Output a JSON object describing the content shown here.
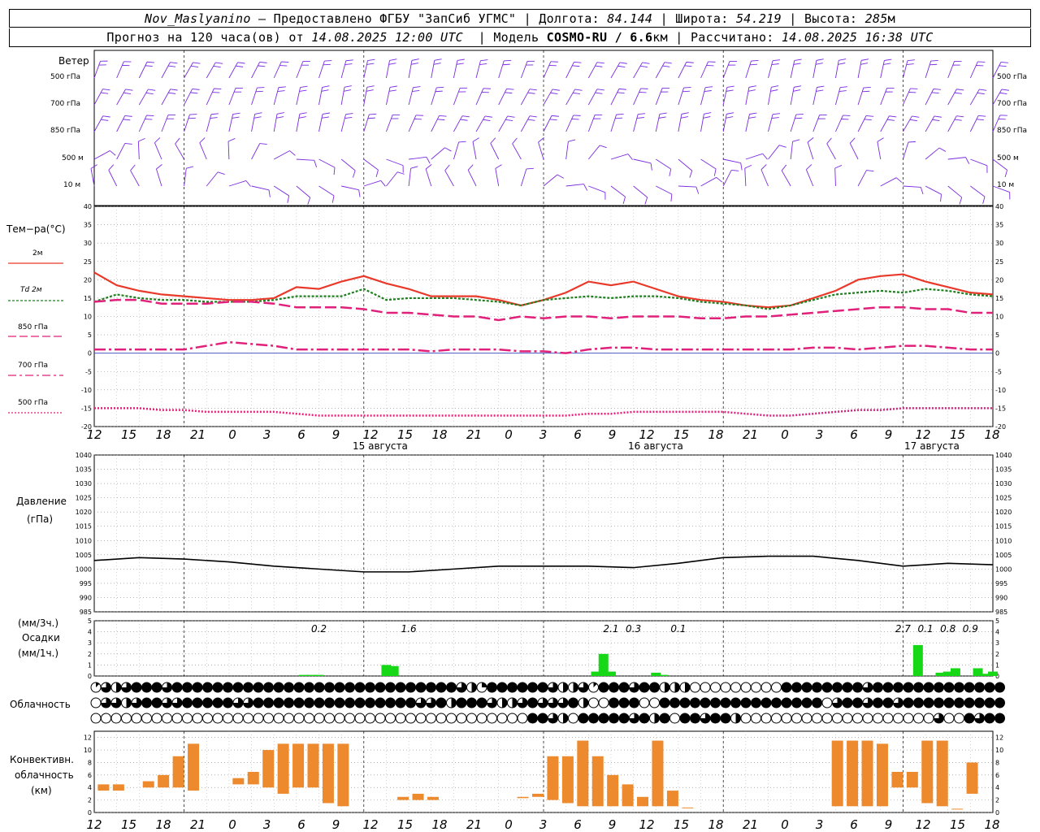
{
  "header": {
    "station": "Nov_Maslyanino",
    "provider": "Предоставлено ФГБУ \"ЗапСиб УГМС\"",
    "lon_label": "Долгота:",
    "lon": "84.144",
    "lat_label": "Широта:",
    "lat": "54.219",
    "alt_label": "Высота:",
    "alt": "285",
    "alt_unit": "м",
    "forecast_prefix": "Прогноз на 120 часа(ов) от",
    "forecast_time": "14.08.2025 12:00 UTC",
    "model_label": "Модель",
    "model": "COSMO-RU / 6.6",
    "model_unit": "км",
    "calc_label": "Рассчитано:",
    "calc_time": "14.08.2025 16:38 UTC"
  },
  "labels": {
    "wind": "Ветер",
    "levels": [
      "500 гПа",
      "700 гПа",
      "850 гПа",
      "500 м",
      "10  м"
    ],
    "temp": "Тем−ра(°С)",
    "t2m": "2м",
    "td": "Td  2м",
    "t850": "850 гПа",
    "t700": "700 гПа",
    "t500": "500 гПа",
    "pressure": "Давление",
    "pressure_unit": "(гПа)",
    "precip_unit3": "(мм/3ч.)",
    "precip": "Осадки",
    "precip_unit1": "(мм/1ч.)",
    "clouds": "Облачность",
    "conv1": "Конвективн.",
    "conv2": "облачность",
    "conv3": "(км)",
    "dates": [
      "15 августа",
      "16 августа",
      "17 августа"
    ],
    "hours": [
      "12",
      "15",
      "18",
      "21",
      "0",
      "3",
      "6",
      "9",
      "12",
      "15",
      "18",
      "21",
      "0",
      "3",
      "6",
      "9",
      "12",
      "15",
      "18",
      "21",
      "0",
      "3",
      "6",
      "9",
      "12",
      "15",
      "18"
    ]
  },
  "colors": {
    "t2m": "#e8392a",
    "td": "#1e7f1e",
    "t850": "#e0207a",
    "t700": "#e0207a",
    "t500": "#e0207a",
    "wind": "#7b2be0",
    "precip": "#17d817",
    "conv": "#ee8a2e",
    "pressure": "#000000"
  },
  "chart_data": [
    {
      "type": "line",
      "name": "temperature",
      "ylim": [
        -20,
        40
      ],
      "x_hours": [
        0,
        3,
        6,
        9,
        12,
        15,
        18,
        21,
        24,
        27,
        30,
        33,
        36,
        39,
        42,
        45,
        48,
        51,
        54,
        57,
        60,
        63,
        66,
        69,
        72,
        75,
        78,
        81,
        84,
        87,
        90,
        93,
        96,
        99,
        102,
        105,
        108,
        111,
        114,
        117,
        120
      ],
      "series": [
        {
          "name": "2м",
          "values": [
            22,
            18.5,
            17,
            16,
            15.5,
            15,
            14.5,
            14.5,
            15,
            18,
            17.5,
            19.5,
            21,
            19,
            17.5,
            15.5,
            15.5,
            15.5,
            14.5,
            13,
            14.5,
            16.5,
            19.5,
            18.5,
            19.5,
            17.5,
            15.5,
            14.5,
            14,
            13,
            12.5,
            13,
            15,
            17,
            20,
            21,
            21.5,
            19.5,
            18,
            16.5,
            16
          ]
        },
        {
          "name": "Td 2м",
          "values": [
            14,
            16,
            15,
            14.5,
            14.5,
            14,
            14,
            14,
            14.5,
            15.5,
            15.5,
            15.5,
            17.5,
            14.5,
            15,
            15,
            15,
            14.5,
            14,
            13,
            14.5,
            15,
            15.5,
            15,
            15.5,
            15.5,
            15,
            14,
            13.5,
            13,
            12,
            13,
            14.5,
            16,
            16.5,
            17,
            16.5,
            17.5,
            17,
            16,
            15.5
          ]
        },
        {
          "name": "850 гПа",
          "values": [
            14,
            14.5,
            14.5,
            13.5,
            13.5,
            13.5,
            14,
            14,
            13.5,
            12.5,
            12.5,
            12.5,
            12,
            11,
            11,
            10.5,
            10,
            10,
            9,
            10,
            9.5,
            10,
            10,
            9.5,
            10,
            10,
            10,
            9.5,
            9.5,
            10,
            10,
            10.5,
            11,
            11.5,
            12,
            12.5,
            12.5,
            12,
            12,
            11,
            11
          ]
        },
        {
          "name": "700 гПа",
          "values": [
            1,
            1,
            1,
            1,
            1,
            2,
            3,
            2.5,
            2,
            1,
            1,
            1,
            1,
            1,
            1,
            0.5,
            1,
            1,
            1,
            0.5,
            0.5,
            0,
            1,
            1.5,
            1.5,
            1,
            1,
            1,
            1,
            1,
            1,
            1,
            1.5,
            1.5,
            1,
            1.5,
            2,
            2,
            1.5,
            1,
            1
          ]
        },
        {
          "name": "500 гПа",
          "values": [
            -15,
            -15,
            -15,
            -15.5,
            -15.5,
            -16,
            -16,
            -16,
            -16,
            -16.5,
            -17,
            -17,
            -17,
            -17,
            -17,
            -17,
            -17,
            -17,
            -17,
            -17,
            -17,
            -17,
            -16.5,
            -16.5,
            -16,
            -16,
            -16,
            -16,
            -16,
            -16.5,
            -17,
            -17,
            -16.5,
            -16,
            -15.5,
            -15.5,
            -15,
            -15,
            -15,
            -15,
            -15
          ]
        }
      ]
    },
    {
      "type": "line",
      "name": "pressure",
      "ylim": [
        985,
        1040
      ],
      "x_hours": [
        0,
        6,
        12,
        18,
        24,
        30,
        36,
        42,
        48,
        54,
        60,
        66,
        72,
        78,
        84,
        90,
        96,
        102,
        108,
        114,
        120
      ],
      "series": [
        {
          "name": "pressure",
          "values": [
            1003,
            1004,
            1003.5,
            1002.5,
            1001,
            1000,
            999,
            999,
            1000,
            1001,
            1001,
            1001,
            1000.5,
            1002,
            1004,
            1004.5,
            1004.5,
            1003,
            1001,
            1002,
            1001.5
          ]
        }
      ]
    },
    {
      "type": "bar",
      "name": "precipitation",
      "ylim": [
        0,
        5
      ],
      "labels": [
        {
          "x_hour": 30,
          "text": "0.2"
        },
        {
          "x_hour": 42,
          "text": "1.6"
        },
        {
          "x_hour": 69,
          "text": "2.1"
        },
        {
          "x_hour": 72,
          "text": "0.3"
        },
        {
          "x_hour": 78,
          "text": "0.1"
        },
        {
          "x_hour": 108,
          "text": "2.7"
        },
        {
          "x_hour": 111,
          "text": "0.1"
        },
        {
          "x_hour": 114,
          "text": "0.8"
        },
        {
          "x_hour": 117,
          "text": "0.9"
        }
      ],
      "bars": [
        [
          28,
          0.1
        ],
        [
          29,
          0.1
        ],
        [
          30,
          0.1
        ],
        [
          39,
          1
        ],
        [
          40,
          0.9
        ],
        [
          67,
          0.4
        ],
        [
          68,
          2
        ],
        [
          69,
          0.4
        ],
        [
          75,
          0.3
        ],
        [
          76,
          0.1
        ],
        [
          110,
          2.8
        ],
        [
          113,
          0.3
        ],
        [
          114,
          0.4
        ],
        [
          115,
          0.7
        ],
        [
          118,
          0.7
        ],
        [
          119,
          0.2
        ],
        [
          120,
          0.4
        ]
      ]
    },
    {
      "type": "bar",
      "name": "convective",
      "ylim": [
        0,
        13
      ],
      "x_hours": [
        2,
        4,
        6,
        8,
        10,
        12,
        14,
        16,
        18,
        20,
        22,
        24,
        26,
        28,
        30,
        32,
        34,
        36,
        38,
        40,
        42,
        44,
        46,
        48,
        50,
        52,
        54,
        56,
        58,
        60,
        62,
        64,
        66,
        68,
        70,
        72,
        74,
        76,
        78,
        80,
        82,
        84,
        86,
        88,
        90,
        92,
        94,
        96,
        98,
        100,
        102,
        104,
        106,
        108,
        110,
        112,
        114,
        116,
        118,
        120
      ],
      "ranges": [
        [
          3.5,
          4.5
        ],
        [
          3.5,
          4.5
        ],
        null,
        [
          4,
          5
        ],
        [
          4,
          6
        ],
        [
          4,
          9
        ],
        [
          3.5,
          11
        ],
        null,
        null,
        [
          4.5,
          5.5
        ],
        [
          4.5,
          6.5
        ],
        [
          4,
          10
        ],
        [
          3,
          11
        ],
        [
          4,
          11
        ],
        [
          4,
          11
        ],
        [
          1.5,
          11
        ],
        [
          1,
          11
        ],
        null,
        null,
        null,
        [
          2,
          2.5
        ],
        [
          2,
          3
        ],
        [
          2,
          2.5
        ],
        null,
        null,
        null,
        null,
        null,
        [
          2.3,
          2.5
        ],
        [
          2.5,
          3
        ],
        [
          2,
          9
        ],
        [
          1.5,
          9
        ],
        [
          1,
          11.5
        ],
        [
          1,
          9
        ],
        [
          1,
          6
        ],
        [
          1,
          4.5
        ],
        [
          1,
          2.5
        ],
        [
          1,
          11.5
        ],
        [
          1,
          3.5
        ],
        [
          0.7,
          0.8
        ],
        null,
        null,
        null,
        null,
        null,
        null,
        null,
        null,
        null,
        [
          1,
          11.5
        ],
        [
          1,
          11.5
        ],
        [
          1,
          11.5
        ],
        [
          1,
          11
        ],
        [
          4,
          6.5
        ],
        [
          4,
          6.5
        ],
        [
          1.5,
          11.5
        ],
        [
          1,
          11.5
        ],
        [
          0.5,
          0.6
        ],
        [
          3,
          8
        ]
      ]
    },
    {
      "type": "table",
      "name": "cloud_cover",
      "rows": [
        "high",
        "mid",
        "low"
      ],
      "values_octas": {
        "high": [
          1,
          6,
          4,
          6,
          8,
          8,
          8,
          6,
          8,
          8,
          8,
          8,
          8,
          8,
          8,
          8,
          8,
          8,
          8,
          8,
          8,
          8,
          8,
          8,
          8,
          8,
          8,
          8,
          8,
          8,
          8,
          8,
          8,
          8,
          8,
          8,
          6,
          4,
          2,
          8,
          8,
          8,
          8,
          8,
          8,
          6,
          4,
          4,
          6,
          1,
          8,
          8,
          8,
          6,
          8,
          8,
          4,
          4,
          4,
          0,
          0,
          0,
          0,
          0,
          0,
          0,
          0,
          0,
          8,
          8,
          8,
          8,
          8,
          8,
          8,
          8,
          6,
          8,
          8,
          8,
          8,
          8,
          8,
          8,
          8,
          8,
          8,
          8,
          8,
          8
        ],
        "mid": [
          0,
          6,
          6,
          4,
          6,
          8,
          8,
          6,
          6,
          8,
          8,
          8,
          8,
          8,
          6,
          6,
          8,
          8,
          8,
          8,
          8,
          8,
          8,
          8,
          8,
          8,
          8,
          8,
          8,
          8,
          8,
          8,
          6,
          6,
          8,
          4,
          8,
          8,
          8,
          6,
          4,
          4,
          6,
          8,
          6,
          6,
          6,
          8,
          4,
          0,
          0,
          8,
          8,
          8,
          0,
          0,
          8,
          8,
          8,
          8,
          8,
          8,
          8,
          8,
          8,
          8,
          8,
          8,
          8,
          8,
          8,
          8,
          0,
          6,
          8,
          8,
          6,
          8,
          8,
          6,
          8,
          8,
          8,
          8,
          8,
          8,
          8,
          8,
          8,
          8
        ],
        "low": [
          0,
          0,
          0,
          0,
          0,
          0,
          0,
          0,
          0,
          0,
          0,
          0,
          0,
          0,
          0,
          0,
          0,
          0,
          0,
          0,
          0,
          0,
          0,
          0,
          0,
          0,
          0,
          0,
          0,
          0,
          0,
          0,
          0,
          0,
          0,
          0,
          0,
          0,
          0,
          0,
          0,
          0,
          0,
          8,
          8,
          6,
          4,
          0,
          8,
          8,
          8,
          8,
          8,
          6,
          8,
          4,
          8,
          0,
          8,
          8,
          6,
          8,
          8,
          4,
          0,
          0,
          0,
          0,
          0,
          0,
          0,
          0,
          0,
          0,
          0,
          0,
          0,
          0,
          0,
          0,
          0,
          0,
          0,
          6,
          0,
          0,
          8,
          6,
          8,
          8
        ]
      }
    },
    {
      "type": "barbs",
      "name": "wind",
      "levels": [
        "500 гПа",
        "700 гПа",
        "850 гПа",
        "500 м",
        "10 м"
      ]
    }
  ]
}
